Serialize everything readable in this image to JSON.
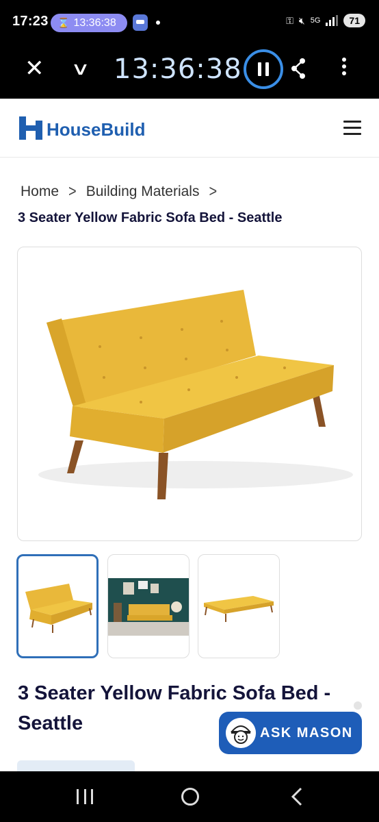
{
  "status_bar": {
    "time": "17:23",
    "chip_timer": "13:36:38",
    "network": "5G",
    "battery": "71"
  },
  "recorder": {
    "timer": "13:36:38"
  },
  "header": {
    "brand": "HouseBuild",
    "brand_color": "#1f5fb0"
  },
  "breadcrumb": {
    "items": [
      "Home",
      "Building Materials"
    ],
    "separator": ">",
    "current": "3 Seater Yellow Fabric Sofa Bed - Seattle"
  },
  "product": {
    "title": "3 Seater Yellow Fabric Sofa Bed - Seattle",
    "main_image": "yellow-sofa-bed-photo",
    "thumbnails": [
      "sofa-upright-thumb",
      "sofa-in-room-thumb",
      "sofa-flat-bed-thumb"
    ],
    "active_thumbnail": 0
  },
  "chat": {
    "label": "ASK MASON",
    "color": "#1e5db8"
  }
}
